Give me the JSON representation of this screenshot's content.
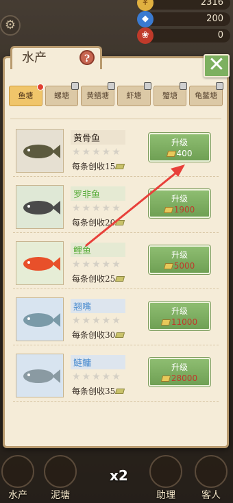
{
  "topbar": {
    "coins": "2316",
    "gems": "200",
    "ticket": "0"
  },
  "panel": {
    "title": "水产",
    "help": "?",
    "close": "✕"
  },
  "tabs": [
    {
      "label": "鱼塘",
      "active": true,
      "badge": true,
      "locked": false
    },
    {
      "label": "螺塘",
      "active": false,
      "badge": false,
      "locked": true
    },
    {
      "label": "黄鳝塘",
      "active": false,
      "badge": false,
      "locked": true
    },
    {
      "label": "虾塘",
      "active": false,
      "badge": false,
      "locked": true
    },
    {
      "label": "蟹塘",
      "active": false,
      "badge": false,
      "locked": true
    },
    {
      "label": "龟鳖塘",
      "active": false,
      "badge": false,
      "locked": true
    }
  ],
  "fish": [
    {
      "name": "黄骨鱼",
      "income": "每条创收15",
      "upgrade": "升级",
      "cost": "400",
      "stars": "★★★★★",
      "name_color": "#3a3028",
      "name_bg": "#ede3cf",
      "thumb_bg": "#e6e0d2",
      "active": true
    },
    {
      "name": "罗非鱼",
      "income": "每条创收20",
      "upgrade": "升级",
      "cost": "1900",
      "stars": "★★★★★",
      "name_color": "#5cae3f",
      "name_bg": "#e5ead3",
      "thumb_bg": "#dfe8d6",
      "active": false
    },
    {
      "name": "鲤鱼",
      "income": "每条创收25",
      "upgrade": "升级",
      "cost": "5000",
      "stars": "★★★★★",
      "name_color": "#5cae3f",
      "name_bg": "#e5ead3",
      "thumb_bg": "#e6edd6",
      "active": false
    },
    {
      "name": "翘嘴",
      "income": "每条创收30",
      "upgrade": "升级",
      "cost": "11000",
      "stars": "★★★★★",
      "name_color": "#4f8fd0",
      "name_bg": "#dde5ee",
      "thumb_bg": "#d8e4f0",
      "active": false
    },
    {
      "name": "鲢鳙",
      "income": "每条创收35",
      "upgrade": "升级",
      "cost": "28000",
      "stars": "★★★★★",
      "name_color": "#4f8fd0",
      "name_bg": "#dde5ee",
      "thumb_bg": "#d8e4f0",
      "active": false
    }
  ],
  "bottom_nav": [
    {
      "label": "水产"
    },
    {
      "label": "泥塘"
    },
    {
      "label": "助理"
    },
    {
      "label": "客人"
    }
  ],
  "multiplier": "x2",
  "colors": {
    "panel_bg": "#f5ecd8",
    "panel_border": "#b89a6e",
    "button_green": "#7db060",
    "cost_red": "#c0392b",
    "arrow": "#e8403a"
  }
}
